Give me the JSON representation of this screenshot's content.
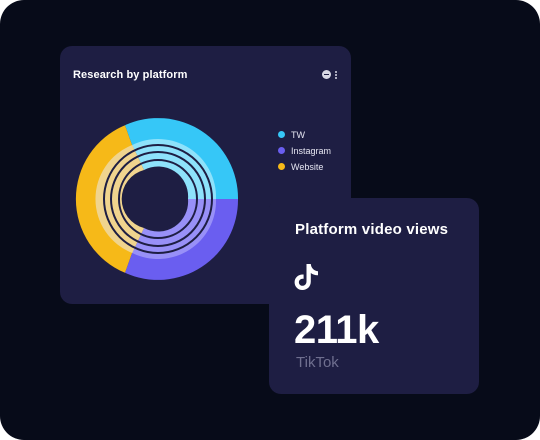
{
  "research_card": {
    "title": "Research by platform",
    "legend": [
      {
        "label": "TW",
        "color": "#36c7f7"
      },
      {
        "label": "Instagram",
        "color": "#6a5ef0"
      },
      {
        "label": "Website",
        "color": "#f6b918"
      }
    ]
  },
  "views_card": {
    "title": "Platform video views",
    "value": "211k",
    "platform": "TikTok",
    "icon": "tiktok-icon"
  }
}
